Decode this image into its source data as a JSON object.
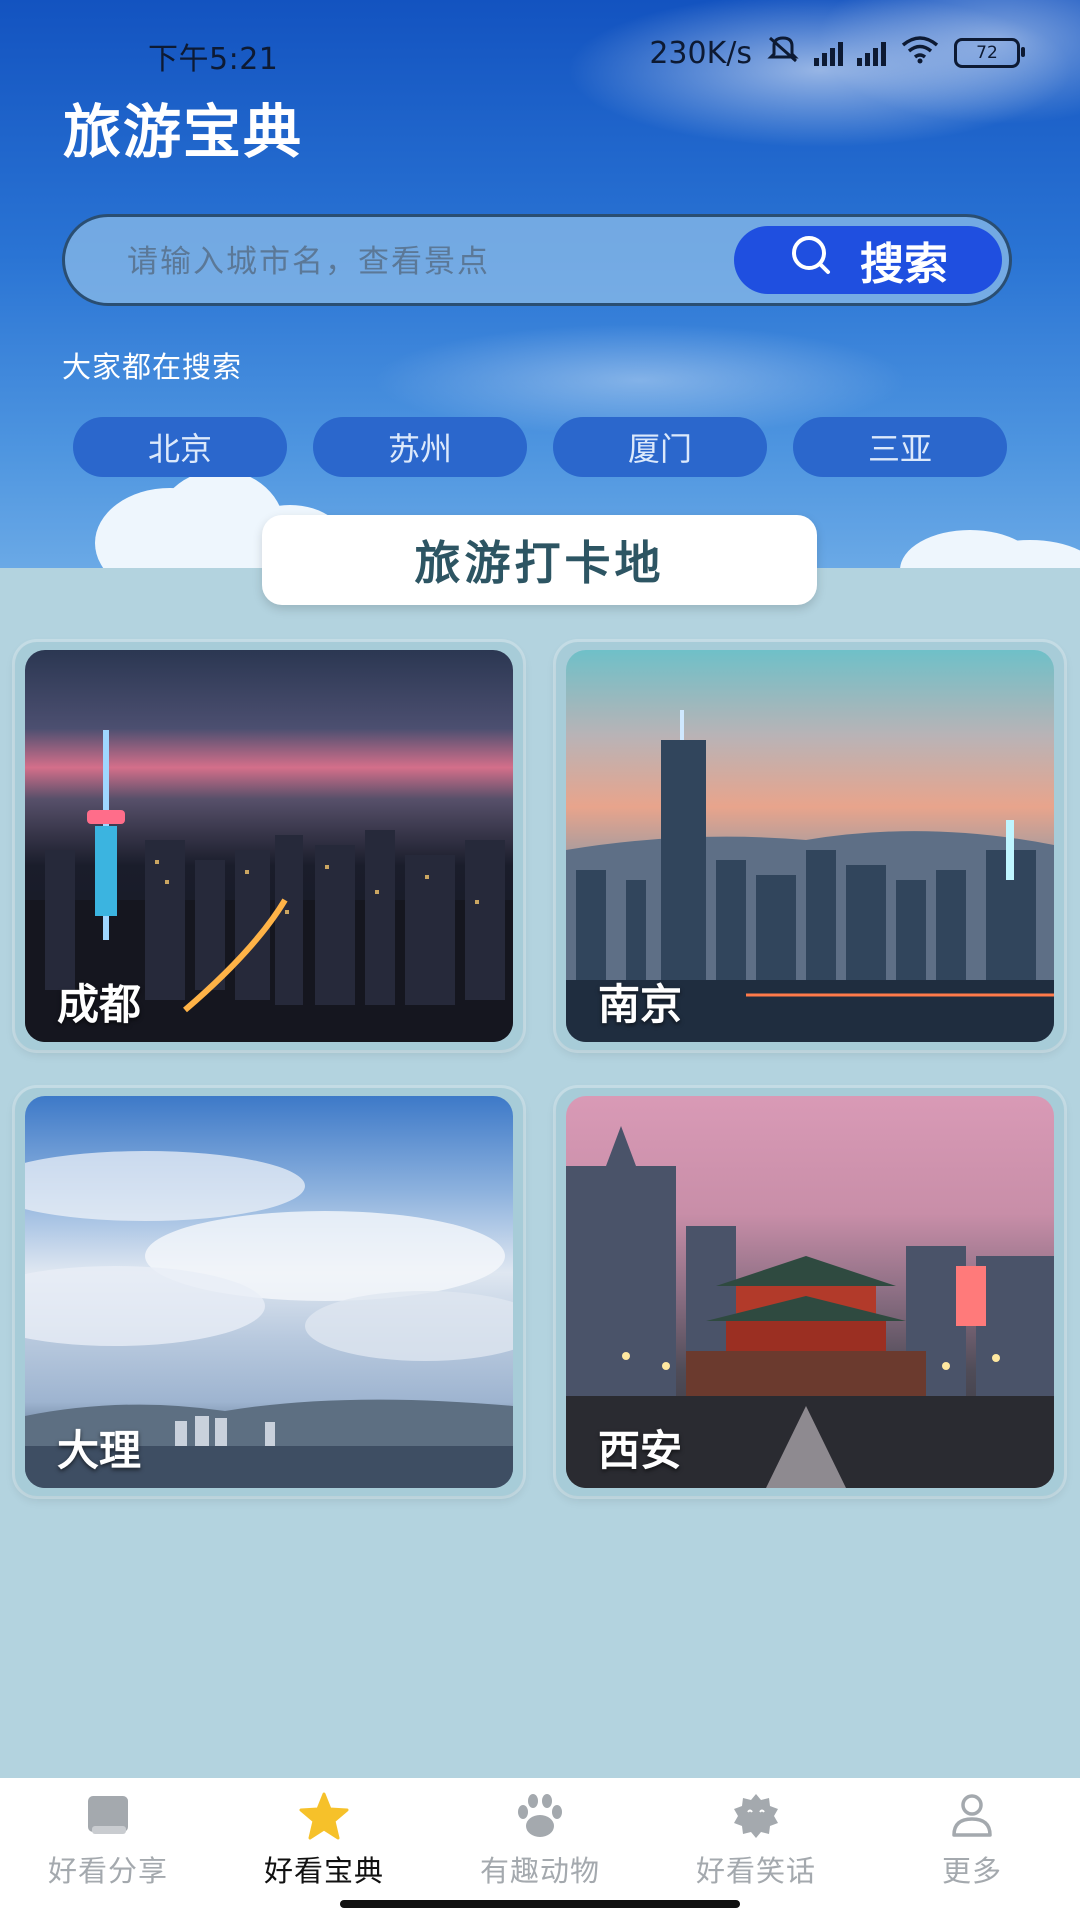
{
  "status_bar": {
    "time": "下午5:21",
    "speed": "230K/s",
    "battery": "72"
  },
  "app": {
    "title": "旅游宝典"
  },
  "search": {
    "placeholder": "请输入城市名，查看景点",
    "button_label": "搜索"
  },
  "popular": {
    "label": "大家都在搜索",
    "chips": [
      "北京",
      "苏州",
      "厦门",
      "三亚"
    ]
  },
  "section": {
    "title": "旅游打卡地"
  },
  "cards": [
    {
      "name": "成都"
    },
    {
      "name": "南京"
    },
    {
      "name": "大理"
    },
    {
      "name": "西安"
    }
  ],
  "nav": {
    "items": [
      {
        "label": "好看分享",
        "icon": "book-icon",
        "active": false
      },
      {
        "label": "好看宝典",
        "icon": "star-icon",
        "active": true
      },
      {
        "label": "有趣动物",
        "icon": "paw-icon",
        "active": false
      },
      {
        "label": "好看笑话",
        "icon": "smile-badge-icon",
        "active": false
      },
      {
        "label": "更多",
        "icon": "person-icon",
        "active": false
      }
    ]
  },
  "colors": {
    "accent": "#1f4fe0",
    "chip": "#2b67cc",
    "page_background": "#b3d3df",
    "nav_active_icon": "#f6c12a",
    "nav_inactive": "#a4a9ae"
  }
}
